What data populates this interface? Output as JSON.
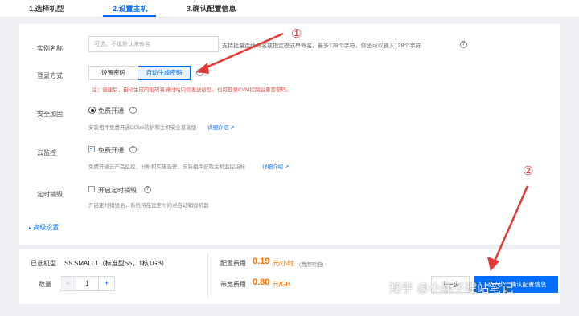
{
  "steps": [
    "1.选择机型",
    "2.设置主机",
    "3.确认配置信息"
  ],
  "instance_name": {
    "label": "实例名称",
    "placeholder": "可选，不填默认未命名",
    "hint": "支持批量连续命名或指定模式串命名，最多128个字符，你还可以输入128个字符"
  },
  "login": {
    "label": "登录方式",
    "option_password": "设置密码",
    "option_auto": "自动生成密码",
    "warning": "注：创建后，自动生成的密码将通过站内信发送给您。也可登录CVM控制台重置密码。"
  },
  "security": {
    "label": "安全加固",
    "option": "免费开通",
    "desc": "安装组件免费开通DDoS防护和主机安全基础版",
    "link": "详细介绍"
  },
  "monitor": {
    "label": "云监控",
    "option": "免费开通",
    "desc": "免费开通云产品监控、分析和实施告警，安装组件获取主机监控指标",
    "link": "详细介绍"
  },
  "destroy": {
    "label": "定时销毁",
    "option": "开启定时销毁",
    "desc": "开启定时销毁后，系统将在设定时间点自动销毁机器"
  },
  "advanced": "高级设置",
  "summary": {
    "model_label": "已选机型",
    "model_value": "S5.SMALL1（标准型S5，1核1GB）",
    "qty_label": "数量",
    "qty_minus": "−",
    "qty_value": "1",
    "qty_plus": "+",
    "config_fee_label": "配置费用",
    "config_fee_value": "0.19",
    "config_fee_unit": "元/小时",
    "config_fee_note": "(费用明细)",
    "bandwidth_fee_label": "带宽费用",
    "bandwidth_fee_value": "0.80",
    "bandwidth_fee_unit": "元/GB"
  },
  "buttons": {
    "prev": "上一步",
    "next": "下一步：确认配置信息"
  },
  "annotations": {
    "marker1": "①",
    "marker2": "②"
  },
  "watermark": "知乎 @小燕子建站笔记",
  "colors": {
    "accent": "#006eff",
    "price": "#ff7200",
    "warning": "#e1504a",
    "annotation": "#e53935"
  }
}
